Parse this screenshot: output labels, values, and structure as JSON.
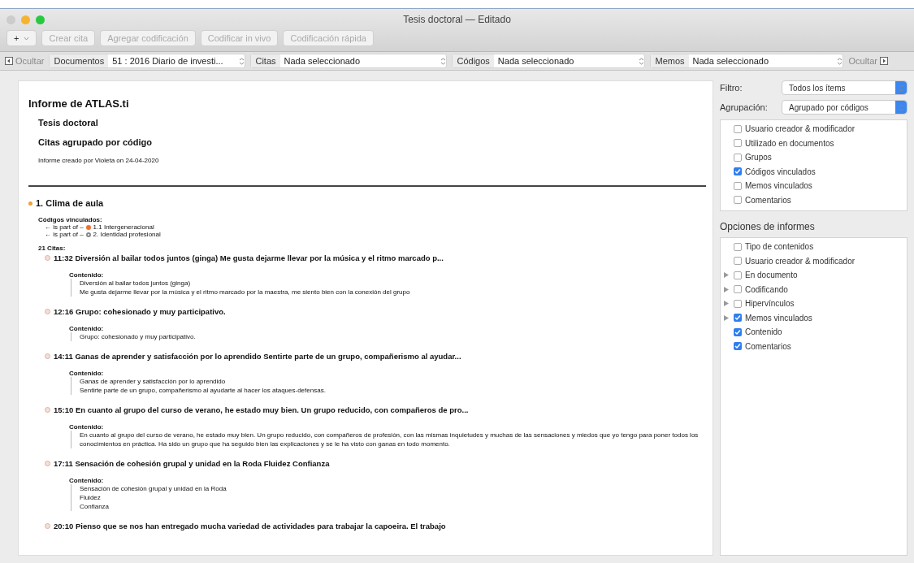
{
  "window": {
    "title": "Tesis doctoral — Editado"
  },
  "toolbar": {
    "add_button": "+",
    "buttons": [
      {
        "label": "Crear cita",
        "disabled": true
      },
      {
        "label": "Agregar codificación",
        "disabled": true
      },
      {
        "label": "Codificar in vivo",
        "disabled": true
      },
      {
        "label": "Codificación rápida",
        "disabled": true
      }
    ]
  },
  "navigator": {
    "hide_left": "Ocultar",
    "documents": {
      "label": "Documentos",
      "value": "51 : 2016 Diario de investi..."
    },
    "selectors": [
      {
        "label": "Citas",
        "value": "Nada seleccionado"
      },
      {
        "label": "Códigos",
        "value": "Nada seleccionado"
      },
      {
        "label": "Memos",
        "value": "Nada seleccionado"
      }
    ],
    "hide_right": "Ocultar"
  },
  "report": {
    "title": "Informe de ATLAS.ti",
    "project": "Tesis doctoral",
    "subtitle": "Citas agrupado por código",
    "created": "Informe creado por Violeta on 24-04-2020",
    "code": {
      "name": "1. Clima de aula",
      "color": "#f0a030",
      "linked_label": "Códigos vinculados:",
      "linked": [
        {
          "relation": "← is part of –",
          "name": "1.1 Intergeneracional",
          "kind": "filled",
          "color": "#f07030"
        },
        {
          "relation": "← is part of –",
          "name": "2. Identidad profesional",
          "kind": "hollow",
          "color": "#888888"
        }
      ],
      "count": "21 Citas:",
      "quotations": [
        {
          "title": "11:32 Diversión al bailar todos juntos (ginga) Me gusta dejarme llevar por la música y el ritmo marcado p...",
          "content_label": "Contenido:",
          "lines": [
            "Diversión al bailar todos juntos (ginga)",
            "Me gusta dejarme llevar por la música y el ritmo marcado por la maestra, me siento bien con la conexión del grupo"
          ]
        },
        {
          "title": "12:16 Grupo: cohesionado y muy participativo.",
          "content_label": "Contenido:",
          "lines": [
            "Grupo: cohesionado y muy participativo."
          ]
        },
        {
          "title": "14:11 Ganas de aprender y satisfacción por lo aprendido Sentirte parte de un grupo, compañerismo al ayudar...",
          "content_label": "Contenido:",
          "lines": [
            "Ganas de aprender y satisfacción por lo aprendido",
            "Sentirte parte de un grupo, compañerismo al ayudarte al hacer los ataques-defensas."
          ]
        },
        {
          "title": "15:10 En cuanto al grupo del curso de verano, he estado muy bien. Un grupo reducido, con compañeros de pro...",
          "content_label": "Contenido:",
          "lines": [
            "En cuanto al grupo del curso de verano, he estado muy bien. Un grupo reducido, con compañeros de profesión, con las mismas inquietudes y muchas de las sensaciones y miedos que yo tengo para poner todos los conocimientos en práctica. Ha sido un grupo que ha seguido bien las explicaciones y se le ha visto con ganas en todo momento."
          ]
        },
        {
          "title": "17:11 Sensación de cohesión grupal y unidad en la Roda Fluidez Confianza",
          "content_label": "Contenido:",
          "lines": [
            "Sensación de cohesión grupal y unidad en la Roda",
            "Fluidez",
            "Confianza"
          ]
        },
        {
          "title": "20:10 Pienso que se nos han entregado mucha variedad de actividades para trabajar la capoeira. El trabajo"
        }
      ]
    }
  },
  "sidebar": {
    "filter": {
      "label": "Filtro:",
      "value": "Todos los ítems"
    },
    "grouping": {
      "label": "Agrupación:",
      "value": "Agrupado por códigos"
    },
    "group_options": [
      {
        "label": "Usuario creador & modificador",
        "checked": false
      },
      {
        "label": "Utilizado en documentos",
        "checked": false
      },
      {
        "label": "Grupos",
        "checked": false
      },
      {
        "label": "Códigos vinculados",
        "checked": true
      },
      {
        "label": "Memos vinculados",
        "checked": false
      },
      {
        "label": "Comentarios",
        "checked": false
      }
    ],
    "report_options_title": "Opciones de informes",
    "report_options": [
      {
        "label": "Tipo de contenidos",
        "checked": false,
        "expandable": false
      },
      {
        "label": "Usuario creador & modificador",
        "checked": false,
        "expandable": false
      },
      {
        "label": "En documento",
        "checked": false,
        "expandable": true
      },
      {
        "label": "Codificando",
        "checked": false,
        "expandable": true
      },
      {
        "label": "Hipervínculos",
        "checked": false,
        "expandable": true
      },
      {
        "label": "Memos vinculados",
        "checked": true,
        "expandable": true
      },
      {
        "label": "Contenido",
        "checked": true,
        "expandable": false
      },
      {
        "label": "Comentarios",
        "checked": true,
        "expandable": false
      }
    ]
  }
}
